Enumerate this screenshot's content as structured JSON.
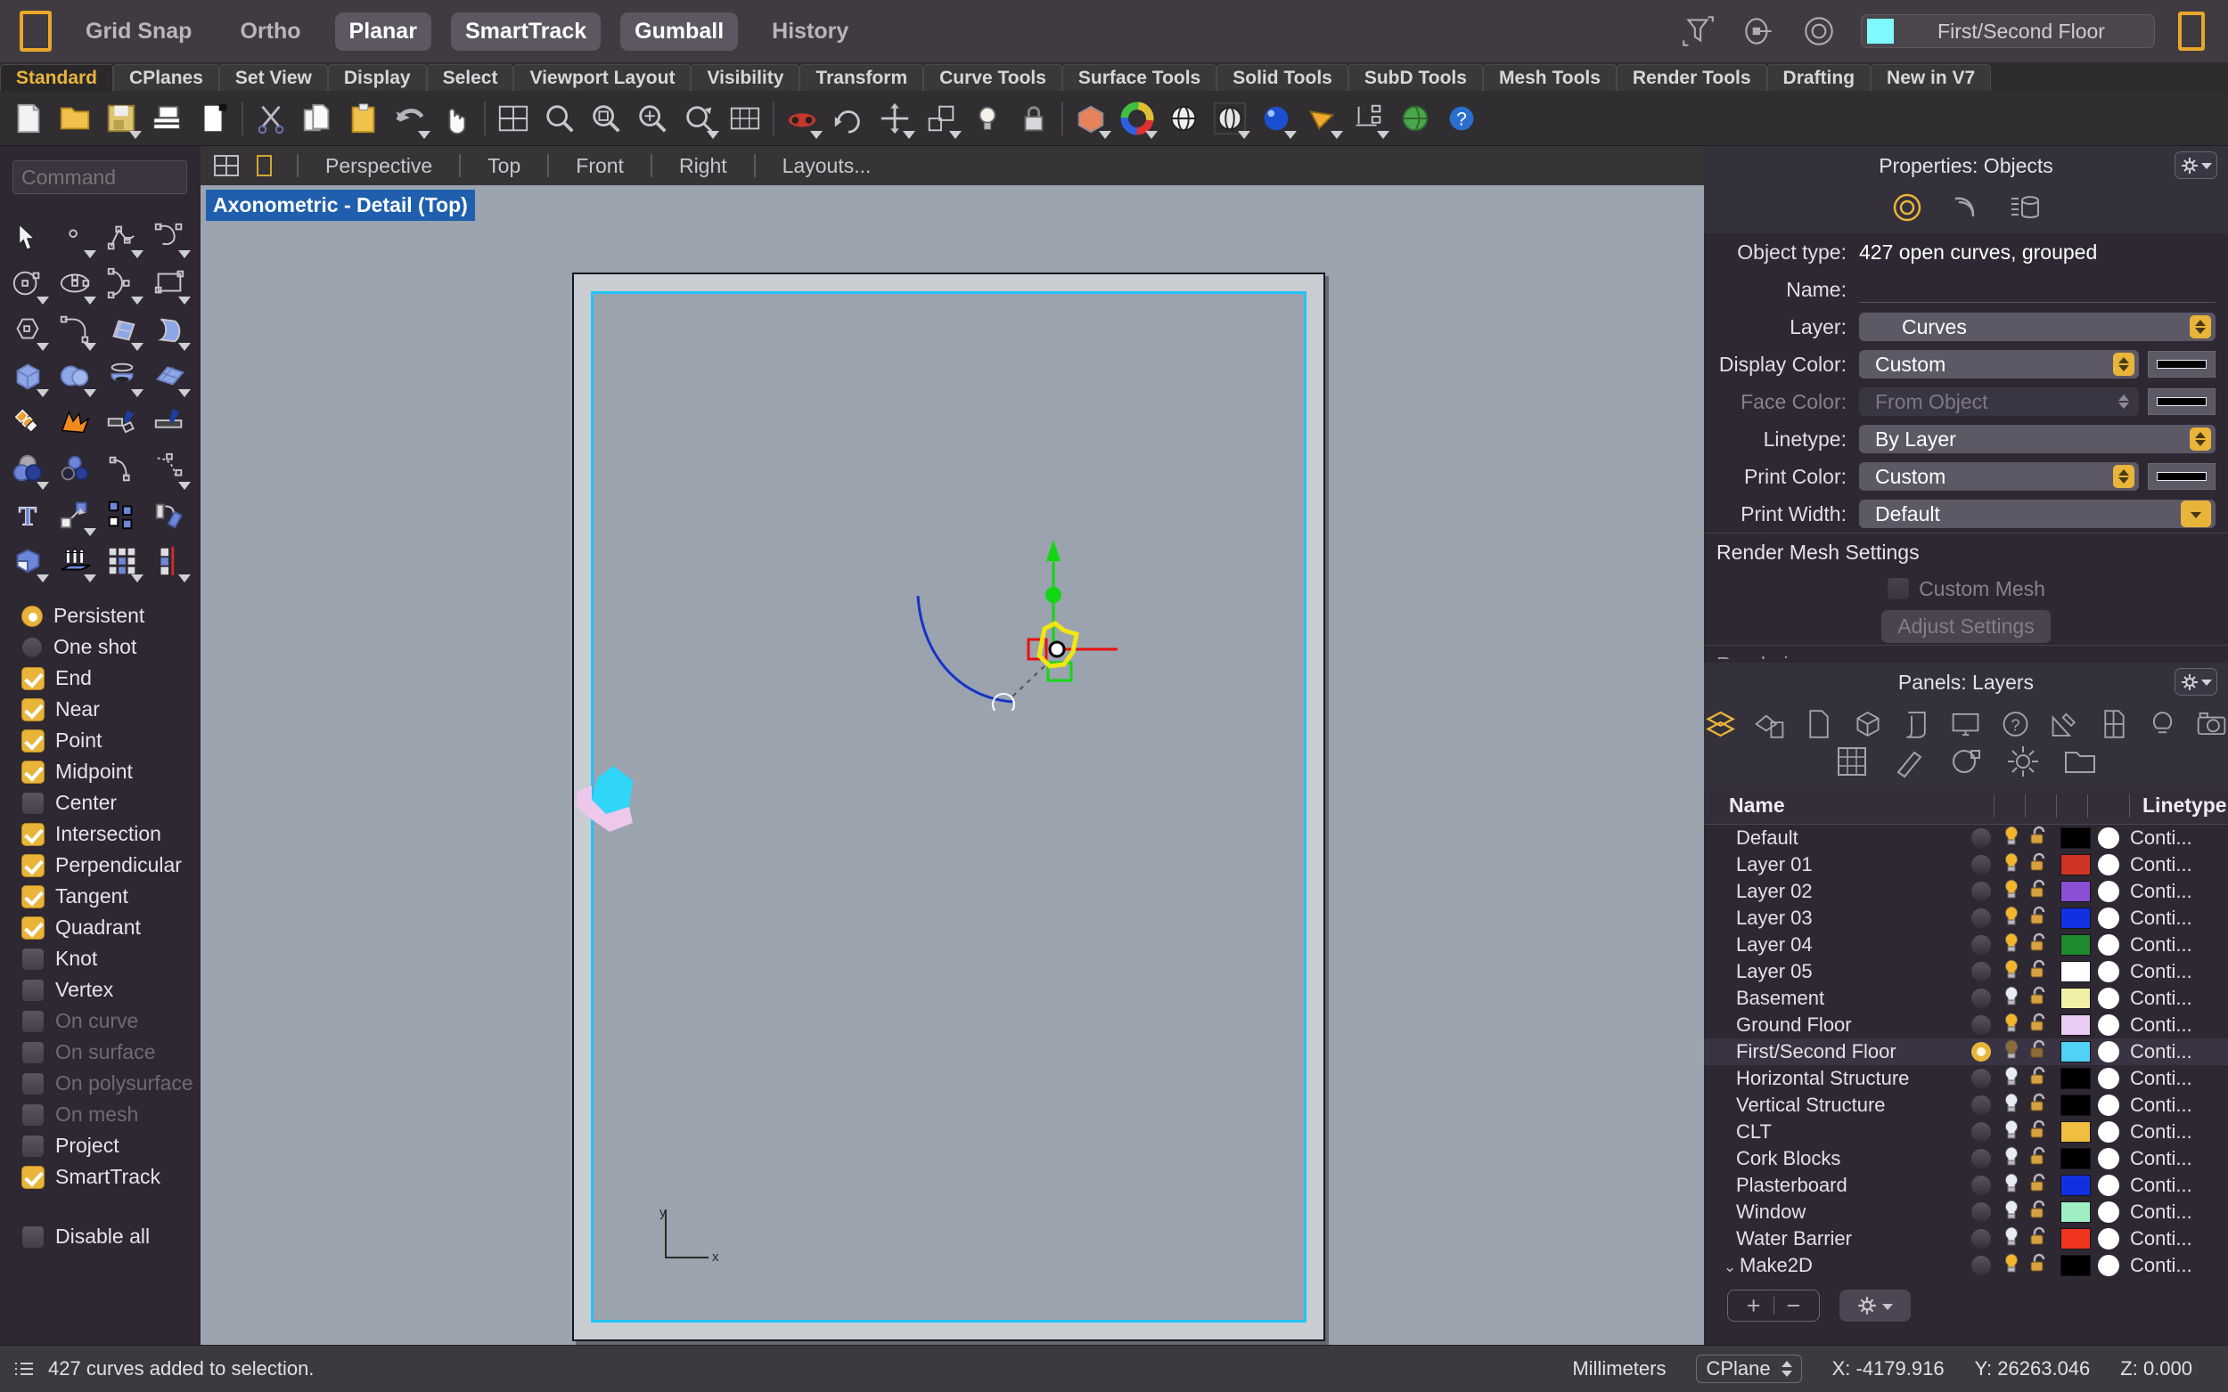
{
  "top_bar": {
    "logo": "rhino-logo",
    "items": [
      {
        "label": "Grid Snap",
        "on": false
      },
      {
        "label": "Ortho",
        "on": false
      },
      {
        "label": "Planar",
        "on": true
      },
      {
        "label": "SmartTrack",
        "on": true
      },
      {
        "label": "Gumball",
        "on": true
      },
      {
        "label": "History",
        "on": false
      }
    ],
    "icons": [
      "filter-icon",
      "point-on-circle-icon",
      "target-circle-icon"
    ],
    "current_layer": {
      "name": "First/Second Floor",
      "color": "#7df9ff"
    }
  },
  "tabs": [
    {
      "label": "Standard",
      "active": true
    },
    {
      "label": "CPlanes",
      "active": false
    },
    {
      "label": "Set View",
      "active": false
    },
    {
      "label": "Display",
      "active": false
    },
    {
      "label": "Select",
      "active": false
    },
    {
      "label": "Viewport Layout",
      "active": false
    },
    {
      "label": "Visibility",
      "active": false
    },
    {
      "label": "Transform",
      "active": false
    },
    {
      "label": "Curve Tools",
      "active": false
    },
    {
      "label": "Surface Tools",
      "active": false
    },
    {
      "label": "Solid Tools",
      "active": false
    },
    {
      "label": "SubD Tools",
      "active": false
    },
    {
      "label": "Mesh Tools",
      "active": false
    },
    {
      "label": "Render Tools",
      "active": false
    },
    {
      "label": "Drafting",
      "active": false
    },
    {
      "label": "New in V7",
      "active": false
    }
  ],
  "command": {
    "placeholder": "Command",
    "value": ""
  },
  "osnap": {
    "modes": [
      {
        "label": "Persistent",
        "type": "radio",
        "checked": true,
        "disabled": false
      },
      {
        "label": "One shot",
        "type": "radio",
        "checked": false,
        "disabled": false
      }
    ],
    "snaps": [
      {
        "label": "End",
        "checked": true,
        "disabled": false
      },
      {
        "label": "Near",
        "checked": true,
        "disabled": false
      },
      {
        "label": "Point",
        "checked": true,
        "disabled": false
      },
      {
        "label": "Midpoint",
        "checked": true,
        "disabled": false
      },
      {
        "label": "Center",
        "checked": false,
        "disabled": false
      },
      {
        "label": "Intersection",
        "checked": true,
        "disabled": false
      },
      {
        "label": "Perpendicular",
        "checked": true,
        "disabled": false
      },
      {
        "label": "Tangent",
        "checked": true,
        "disabled": false
      },
      {
        "label": "Quadrant",
        "checked": true,
        "disabled": false
      },
      {
        "label": "Knot",
        "checked": false,
        "disabled": false
      },
      {
        "label": "Vertex",
        "checked": false,
        "disabled": false
      },
      {
        "label": "On curve",
        "checked": false,
        "disabled": true
      },
      {
        "label": "On surface",
        "checked": false,
        "disabled": true
      },
      {
        "label": "On polysurface",
        "checked": false,
        "disabled": true
      },
      {
        "label": "On mesh",
        "checked": false,
        "disabled": true
      },
      {
        "label": "Project",
        "checked": false,
        "disabled": false
      },
      {
        "label": "SmartTrack",
        "checked": true,
        "disabled": false
      }
    ],
    "disable_all": {
      "label": "Disable all",
      "checked": false
    }
  },
  "viewport": {
    "tab_items": [
      "Perspective",
      "Top",
      "Front",
      "Right",
      "Layouts..."
    ],
    "label": "Axonometric - Detail (Top)",
    "axis_x": "x",
    "axis_y": "y",
    "detail_border_color": "#22c3f5"
  },
  "properties": {
    "title": "Properties: Objects",
    "tabs": [
      "object-properties-icon",
      "curve-properties-icon",
      "material-properties-icon"
    ],
    "object_type_label": "Object type:",
    "object_type_value": "427 open curves, grouped",
    "fields": [
      {
        "label": "Name:",
        "type": "text",
        "value": "",
        "disabled": false
      },
      {
        "label": "Layer:",
        "type": "select",
        "value": "Curves",
        "disabled": false,
        "swatch": false
      },
      {
        "label": "Display Color:",
        "type": "select",
        "value": "Custom",
        "disabled": false,
        "swatch": true
      },
      {
        "label": "Face Color:",
        "type": "select",
        "value": "From Object",
        "disabled": true,
        "swatch": true
      },
      {
        "label": "Linetype:",
        "type": "select",
        "value": "By Layer",
        "disabled": false,
        "swatch": false
      },
      {
        "label": "Print Color:",
        "type": "select",
        "value": "Custom",
        "disabled": false,
        "swatch": true
      },
      {
        "label": "Print Width:",
        "type": "select",
        "value": "Default",
        "disabled": false,
        "swatch": false
      }
    ],
    "render_mesh_heading": "Render Mesh Settings",
    "custom_mesh_label": "Custom Mesh",
    "adjust_settings_label": "Adjust Settings",
    "rendering_heading": "Rendering"
  },
  "layers_panel": {
    "title": "Panels: Layers",
    "icons_row1": [
      "layers-icon",
      "materials-icon",
      "document-icon",
      "object-icon",
      "notes-icon",
      "display-icon",
      "help-icon",
      "tools-icon",
      "properties-icon",
      "light-icon",
      "camera-icon"
    ],
    "icons_row2": [
      "grid-icon",
      "named-cplane-icon",
      "render-icon",
      "sun-icon",
      "folder-icon"
    ],
    "columns": {
      "name": "Name",
      "linetype": "Linetype"
    },
    "rows": [
      {
        "name": "Default",
        "current": false,
        "bulb": "on",
        "lock": "unlocked",
        "color": "#000000",
        "print": "#ffffff",
        "linetype": "Conti..."
      },
      {
        "name": "Layer 01",
        "current": false,
        "bulb": "on",
        "lock": "unlocked",
        "color": "#cf3424",
        "print": "#ffffff",
        "linetype": "Conti..."
      },
      {
        "name": "Layer 02",
        "current": false,
        "bulb": "on",
        "lock": "unlocked",
        "color": "#8b4fd6",
        "print": "#ffffff",
        "linetype": "Conti..."
      },
      {
        "name": "Layer 03",
        "current": false,
        "bulb": "on",
        "lock": "unlocked",
        "color": "#1330e0",
        "print": "#ffffff",
        "linetype": "Conti..."
      },
      {
        "name": "Layer 04",
        "current": false,
        "bulb": "on",
        "lock": "unlocked",
        "color": "#1f8b2e",
        "print": "#ffffff",
        "linetype": "Conti..."
      },
      {
        "name": "Layer 05",
        "current": false,
        "bulb": "on",
        "lock": "unlocked",
        "color": "#ffffff",
        "print": "#ffffff",
        "linetype": "Conti..."
      },
      {
        "name": "Basement",
        "current": false,
        "bulb": "off",
        "lock": "unlocked",
        "color": "#f2f0a6",
        "print": "#ffffff",
        "linetype": "Conti..."
      },
      {
        "name": "Ground Floor",
        "current": false,
        "bulb": "on",
        "lock": "unlocked",
        "color": "#e9ccf2",
        "print": "#ffffff",
        "linetype": "Conti..."
      },
      {
        "name": "First/Second Floor",
        "current": true,
        "bulb": "dim",
        "lock": "locked",
        "color": "#4fd2f5",
        "print": "#ffffff",
        "linetype": "Conti..."
      },
      {
        "name": "Horizontal Structure",
        "current": false,
        "bulb": "off",
        "lock": "unlocked",
        "color": "#000000",
        "print": "#ffffff",
        "linetype": "Conti..."
      },
      {
        "name": "Vertical Structure",
        "current": false,
        "bulb": "off",
        "lock": "unlocked",
        "color": "#000000",
        "print": "#ffffff",
        "linetype": "Conti..."
      },
      {
        "name": "CLT",
        "current": false,
        "bulb": "off",
        "lock": "unlocked",
        "color": "#f0bf3f",
        "print": "#ffffff",
        "linetype": "Conti..."
      },
      {
        "name": "Cork Blocks",
        "current": false,
        "bulb": "off",
        "lock": "unlocked",
        "color": "#000000",
        "print": "#ffffff",
        "linetype": "Conti..."
      },
      {
        "name": "Plasterboard",
        "current": false,
        "bulb": "off",
        "lock": "unlocked",
        "color": "#1330e0",
        "print": "#ffffff",
        "linetype": "Conti..."
      },
      {
        "name": "Window",
        "current": false,
        "bulb": "off",
        "lock": "unlocked",
        "color": "#9ef0c4",
        "print": "#ffffff",
        "linetype": "Conti..."
      },
      {
        "name": "Water Barrier",
        "current": false,
        "bulb": "off",
        "lock": "unlocked",
        "color": "#f0351f",
        "print": "#ffffff",
        "linetype": "Conti..."
      },
      {
        "name": "Make2D",
        "current": false,
        "bulb": "on",
        "lock": "unlocked",
        "color": "#000000",
        "print": "#ffffff",
        "linetype": "Conti...",
        "expandable": true,
        "expanded": true
      }
    ],
    "footer": {
      "add": "+",
      "remove": "−",
      "gear": "gear-icon"
    }
  },
  "status_bar": {
    "message": "427 curves added to selection.",
    "units": "Millimeters",
    "cplane": "CPlane",
    "x": "X: -4179.916",
    "y": "Y: 26263.046",
    "z": "Z: 0.000"
  }
}
